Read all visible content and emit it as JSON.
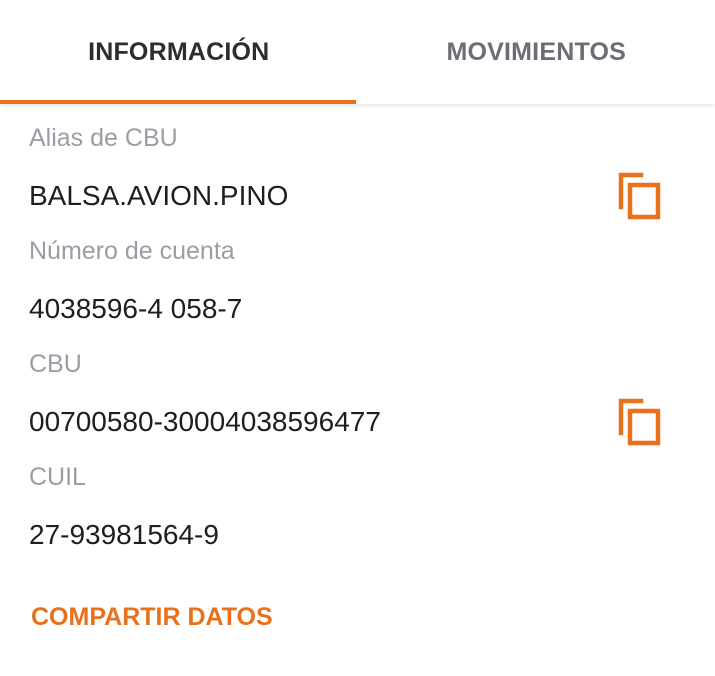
{
  "tabs": [
    {
      "label": "INFORMACIÓN",
      "active": true
    },
    {
      "label": "MOVIMIENTOS",
      "active": false
    }
  ],
  "info": {
    "alias": {
      "label": "Alias de CBU",
      "value": "BALSA.AVION.PINO"
    },
    "cuenta": {
      "label": "Número de cuenta",
      "value": "4038596-4 058-7"
    },
    "cbu": {
      "label": "CBU",
      "value": "00700580-30004038596477"
    },
    "cuil": {
      "label": "CUIL",
      "value": "27-93981564-9"
    }
  },
  "actions": {
    "share_label": "COMPARTIR DATOS"
  },
  "icons": {
    "copy": "copy-icon"
  },
  "colors": {
    "accent": "#e8711d",
    "label": "#9a9ea4",
    "value": "#1e1e1e",
    "tab_active": "#2d2d2d",
    "tab_inactive": "#6b6f75"
  }
}
